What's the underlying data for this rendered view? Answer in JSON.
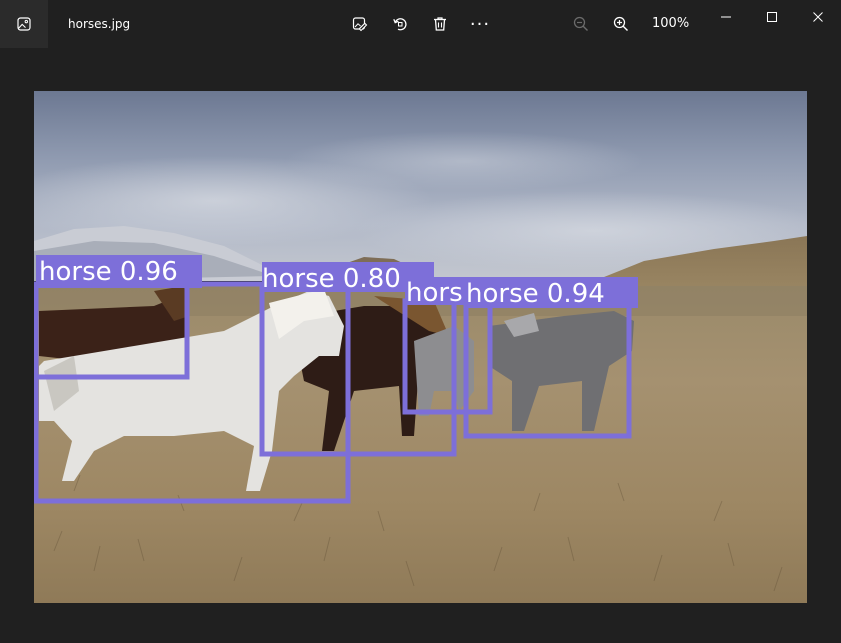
{
  "titlebar": {
    "file_name": "horses.jpg",
    "zoom_level": "100%",
    "more_glyph": "···"
  },
  "icons": {
    "app": "gallery-icon",
    "edit": "edit-image-icon",
    "rotate": "rotate-icon",
    "delete": "trash-icon",
    "more": "more-icon",
    "zoom_out": "zoom-out-icon",
    "zoom_in": "zoom-in-icon",
    "minimize": "minimize-icon",
    "maximize": "maximize-icon",
    "close": "close-icon"
  },
  "colors": {
    "background": "#202020",
    "detection_box": "#7d6fd9",
    "label_text": "#ffffff"
  },
  "detections": [
    {
      "label": "horse 0.96"
    },
    {
      "label": "horse 0.80"
    },
    {
      "label": "hors"
    },
    {
      "label": "horse 0.94"
    }
  ]
}
